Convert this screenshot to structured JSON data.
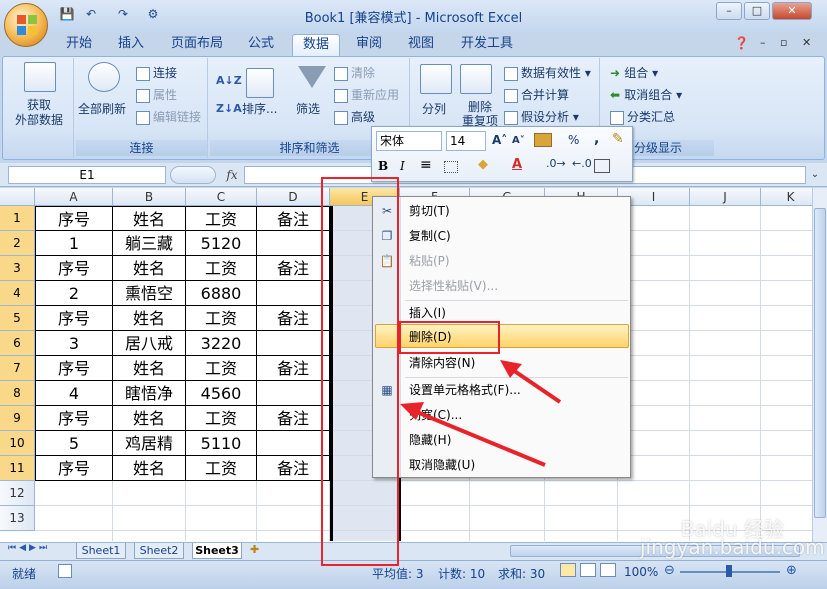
{
  "window": {
    "title": "Book1  [兼容模式] - Microsoft Excel",
    "min_label": "–",
    "max_label": "□",
    "close_label": "✕"
  },
  "tabs": [
    "开始",
    "插入",
    "页面布局",
    "公式",
    "数据",
    "审阅",
    "视图",
    "开发工具"
  ],
  "active_tab": "数据",
  "ribbon": {
    "get_external": "获取\n外部数据",
    "refresh_all": "全部刷新",
    "connections": "连接",
    "properties": "属性",
    "edit_links": "编辑链接",
    "group_connections": "连接",
    "sort": "排序...",
    "filter": "筛选",
    "clear": "清除",
    "reapply": "重新应用",
    "advanced": "高级",
    "group_sort_filter": "排序和筛选",
    "split": "分列",
    "remove_dup": "删除\n重复项",
    "data_validation": "数据有效性",
    "consolidate": "合并计算",
    "whatif": "假设分析",
    "group": "组合",
    "ungroup": "取消组合",
    "subtotal": "分类汇总",
    "group_outline": "分级显示"
  },
  "formula": {
    "namebox": "E1",
    "fx": "fx",
    "value": ""
  },
  "columns": [
    "A",
    "B",
    "C",
    "D",
    "E",
    "F",
    "G",
    "H",
    "I",
    "J",
    "K"
  ],
  "rows": [
    [
      "序号",
      "姓名",
      "工资",
      "备注"
    ],
    [
      "1",
      "躺三藏",
      "5120",
      ""
    ],
    [
      "序号",
      "姓名",
      "工资",
      "备注"
    ],
    [
      "2",
      "熏悟空",
      "6880",
      ""
    ],
    [
      "序号",
      "姓名",
      "工资",
      "备注"
    ],
    [
      "3",
      "居八戒",
      "3220",
      ""
    ],
    [
      "序号",
      "姓名",
      "工资",
      "备注"
    ],
    [
      "4",
      "瞎悟净",
      "4560",
      ""
    ],
    [
      "序号",
      "姓名",
      "工资",
      "备注"
    ],
    [
      "5",
      "鸡居精",
      "5110",
      ""
    ],
    [
      "序号",
      "姓名",
      "工资",
      "备注"
    ],
    [
      "",
      "",
      "",
      ""
    ],
    [
      "",
      "",
      "",
      ""
    ]
  ],
  "row_numbers": [
    "1",
    "2",
    "3",
    "4",
    "5",
    "6",
    "7",
    "8",
    "9",
    "10",
    "11",
    "12",
    "13"
  ],
  "mini_toolbar": {
    "font": "宋体",
    "size": "14",
    "percent": "%",
    "comma": ","
  },
  "context_menu": [
    {
      "label": "剪切(T)",
      "enabled": true
    },
    {
      "label": "复制(C)",
      "enabled": true
    },
    {
      "label": "粘贴(P)",
      "enabled": false
    },
    {
      "label": "选择性粘贴(V)...",
      "enabled": false
    },
    {
      "label": "插入(I)",
      "enabled": true
    },
    {
      "label": "删除(D)",
      "enabled": true
    },
    {
      "label": "清除内容(N)",
      "enabled": true
    },
    {
      "label": "设置单元格格式(F)...",
      "enabled": true
    },
    {
      "label": "列宽(C)...",
      "enabled": true
    },
    {
      "label": "隐藏(H)",
      "enabled": true
    },
    {
      "label": "取消隐藏(U)",
      "enabled": true
    }
  ],
  "sheets": [
    "Sheet1",
    "Sheet2",
    "Sheet3"
  ],
  "active_sheet": "Sheet3",
  "status": {
    "ready": "就绪",
    "average": "平均值: 3",
    "count": "计数: 10",
    "sum": "求和: 30",
    "zoom": "100%"
  },
  "watermark": "Baidu 经验\njingyan.baidu.com",
  "colors": {
    "accent": "#15428b",
    "highlight": "#f9d88a",
    "annotation": "#e8232a"
  }
}
